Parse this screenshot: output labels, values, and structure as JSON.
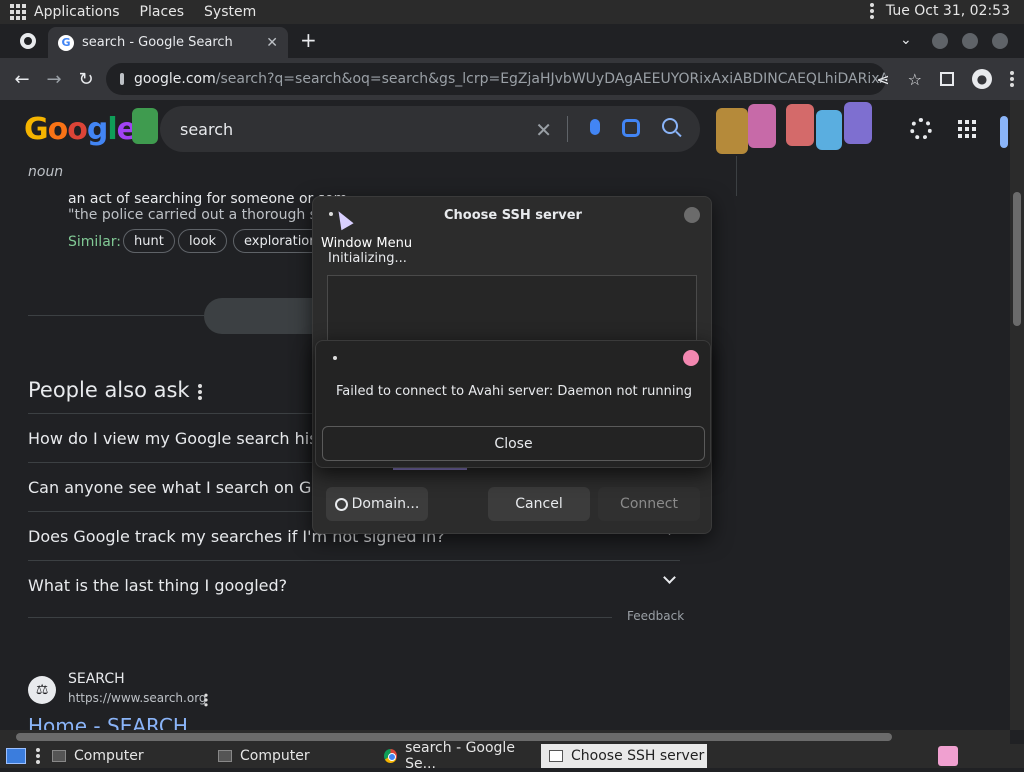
{
  "system_panel": {
    "menus": [
      "Applications",
      "Places",
      "System"
    ],
    "clock": "Tue Oct 31, 02:53"
  },
  "browser": {
    "tab_title": "search - Google Search",
    "url_host": "google.com",
    "url_path": "/search?q=search&oq=search&gs_lcrp=EgZjaHJvbWUyDAgAEEUYORixAxiABDINCAEQLhiDARixAxi..."
  },
  "google": {
    "query": "search",
    "logo": [
      "G",
      "o",
      "o",
      "g",
      "l",
      "e"
    ],
    "part_of_speech": "noun",
    "definition": "an act of searching for someone or som",
    "example": "\"the police carried out a thorough searc",
    "similar_label": "Similar:",
    "similar": [
      "hunt",
      "look",
      "exploration"
    ],
    "paa_title": "People also ask",
    "paa_questions": [
      "How do I view my Google search history",
      "Can anyone see what I search on Googl",
      "Does Google track my searches if I'm not signed in?",
      "What is the last thing I googled?"
    ],
    "feedback": "Feedback",
    "result": {
      "site": "SEARCH",
      "url": "https://www.search.org",
      "title": "Home - SEARCH"
    }
  },
  "ssh_dialog": {
    "title": "Choose SSH server",
    "status": "Initializing...",
    "domain_button": "Domain...",
    "cancel_button": "Cancel",
    "connect_button": "Connect"
  },
  "window_menu_label": "Window Menu",
  "error_dialog": {
    "message": "Failed to connect to Avahi server: Daemon not running",
    "close_button": "Close"
  },
  "taskbar": {
    "items": [
      "Computer",
      "Computer",
      "search - Google Se...",
      "Choose SSH server"
    ]
  },
  "colors": {
    "accent_link": "#8ab4f8",
    "error_close": "#f287b0",
    "progress": "#9b8ce0"
  }
}
